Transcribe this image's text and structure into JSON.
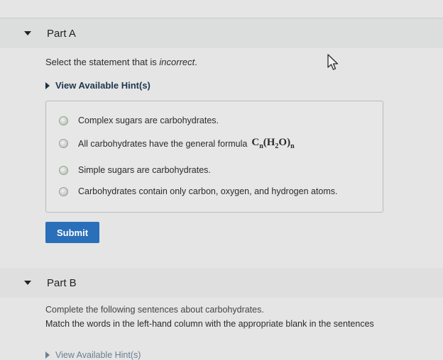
{
  "part_a": {
    "title": "Part A",
    "prompt_before": "Select the statement that is ",
    "prompt_emphasis": "incorrect",
    "prompt_after": ".",
    "hints_label": "View Available Hint(s)",
    "choices": [
      {
        "label": "Complex sugars are carbohydrates."
      },
      {
        "label": "All carbohydrates have the general formula",
        "formula": "Cn(H2O)n"
      },
      {
        "label": "Simple sugars are carbohydrates."
      },
      {
        "label": "Carbohydrates contain only carbon, oxygen, and hydrogen atoms."
      }
    ],
    "submit_label": "Submit"
  },
  "part_b": {
    "title": "Part B",
    "line1": "Complete the following sentences about carbohydrates.",
    "line2": "Match the words in the left-hand column with the appropriate blank in the sentences",
    "hints_label": "View Available Hint(s)"
  },
  "icons": {
    "collapse": "caret-down-icon",
    "hints": "triangle-right-icon",
    "cursor": "mouse-pointer-icon"
  },
  "colors": {
    "submit_bg": "#2a6fb9",
    "hint_text": "#1f3550"
  }
}
